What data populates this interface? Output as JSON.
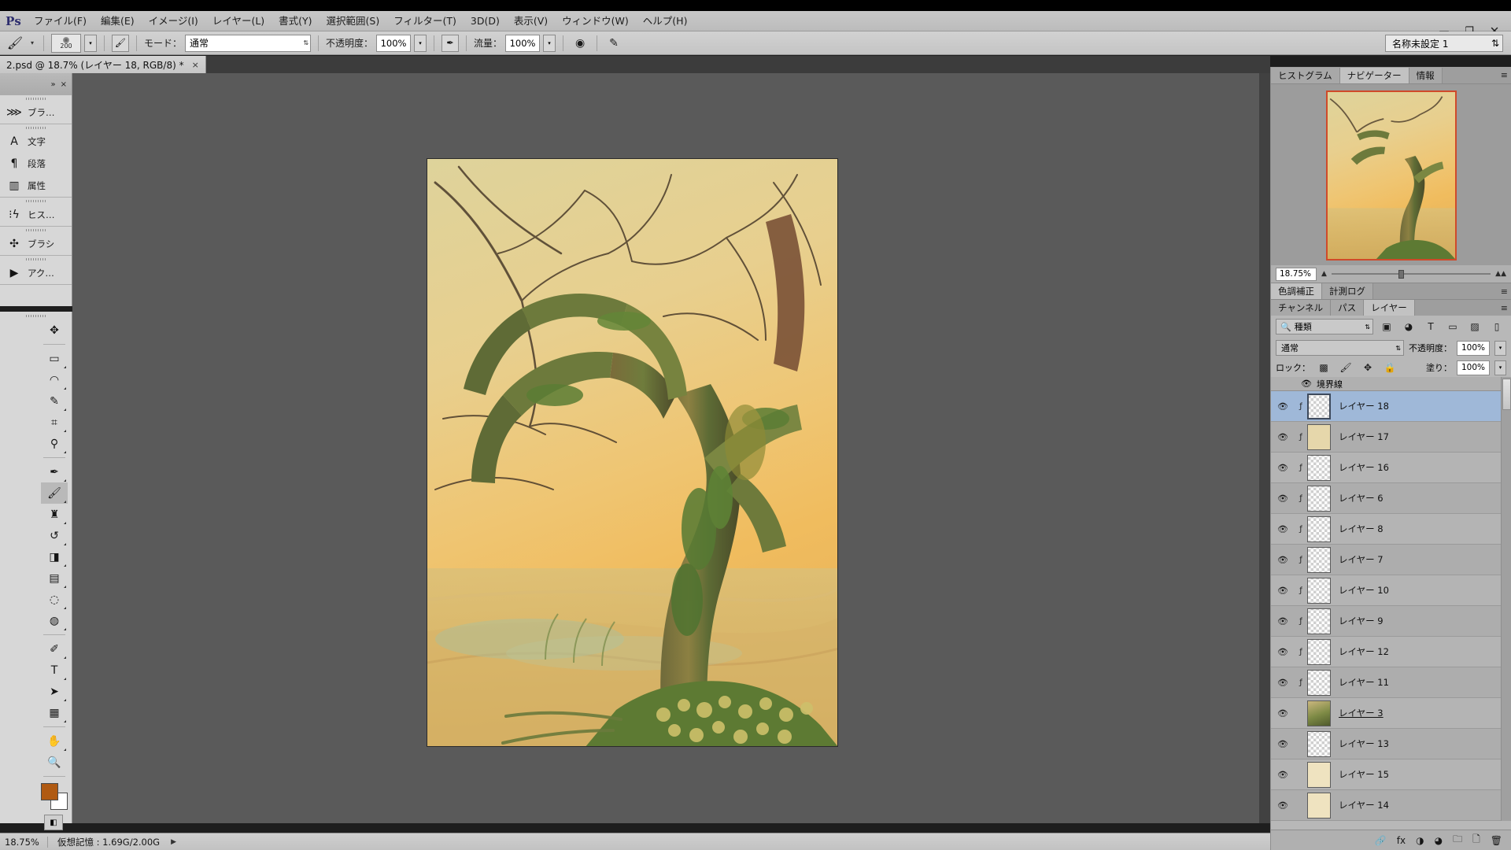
{
  "app": {
    "logo": "Ps",
    "window_controls": [
      {
        "name": "minimize",
        "glyph": "—"
      },
      {
        "name": "maximize",
        "glyph": "❐"
      },
      {
        "name": "close",
        "glyph": "✕"
      }
    ]
  },
  "menubar": {
    "items": [
      {
        "label": "ファイル(F)"
      },
      {
        "label": "編集(E)"
      },
      {
        "label": "イメージ(I)"
      },
      {
        "label": "レイヤー(L)"
      },
      {
        "label": "書式(Y)"
      },
      {
        "label": "選択範囲(S)"
      },
      {
        "label": "フィルター(T)"
      },
      {
        "label": "3D(D)"
      },
      {
        "label": "表示(V)"
      },
      {
        "label": "ウィンドウ(W)"
      },
      {
        "label": "ヘルプ(H)"
      }
    ]
  },
  "options_bar": {
    "tool_icon": "brush-icon",
    "brush_size": "200",
    "brush_preset_icon": "brush-preset-icon",
    "toggle_brush_panel_icon": "brush-panel-toggle-icon",
    "mode_label": "モード：",
    "mode_value": "通常",
    "opacity_label": "不透明度：",
    "opacity_value": "100%",
    "airbrush_icon": "airbrush-icon",
    "flow_label": "流量：",
    "flow_value": "100%",
    "smoothing_icon": "smoothing-icon",
    "tablet_pressure_icon": "tablet-pressure-icon",
    "workspace_value": "名称未設定 1"
  },
  "document_tab": {
    "label": "2.psd @ 18.7% (レイヤー 18, RGB/8) *",
    "close_glyph": "×"
  },
  "left_dock": {
    "collapse_icons": [
      "»",
      "×"
    ],
    "groups": [
      {
        "items": [
          {
            "label": "ブラ…",
            "icon": "brush-settings-icon"
          }
        ]
      },
      {
        "items": [
          {
            "label": "文字",
            "icon": "character-icon"
          },
          {
            "label": "段落",
            "icon": "paragraph-icon"
          },
          {
            "label": "属性",
            "icon": "properties-icon"
          }
        ]
      },
      {
        "items": [
          {
            "label": "ヒス…",
            "icon": "history-icon"
          }
        ]
      },
      {
        "items": [
          {
            "label": "ブラシ",
            "icon": "brushes-icon"
          }
        ]
      },
      {
        "items": [
          {
            "label": "アク…",
            "icon": "actions-icon"
          }
        ]
      }
    ]
  },
  "tools": [
    {
      "name": "move-tool",
      "glyph": "✥",
      "selected": false,
      "has_corner": false
    },
    {
      "name": "rectangular-marquee-tool",
      "glyph": "▭",
      "selected": false,
      "has_corner": true
    },
    {
      "name": "lasso-tool",
      "glyph": "◠",
      "selected": false,
      "has_corner": true
    },
    {
      "name": "quick-selection-tool",
      "glyph": "✎",
      "selected": false,
      "has_corner": true
    },
    {
      "name": "crop-tool",
      "glyph": "⌗",
      "selected": false,
      "has_corner": true
    },
    {
      "name": "eyedropper-tool",
      "glyph": "⚲",
      "selected": false,
      "has_corner": true
    },
    {
      "name": "spot-healing-brush-tool",
      "glyph": "✒",
      "selected": false,
      "has_corner": true
    },
    {
      "name": "brush-tool",
      "glyph": "🖌",
      "selected": true,
      "has_corner": true
    },
    {
      "name": "clone-stamp-tool",
      "glyph": "♜",
      "selected": false,
      "has_corner": true
    },
    {
      "name": "history-brush-tool",
      "glyph": "↺",
      "selected": false,
      "has_corner": true
    },
    {
      "name": "eraser-tool",
      "glyph": "◨",
      "selected": false,
      "has_corner": true
    },
    {
      "name": "gradient-tool",
      "glyph": "▤",
      "selected": false,
      "has_corner": true
    },
    {
      "name": "blur-tool",
      "glyph": "◌",
      "selected": false,
      "has_corner": true
    },
    {
      "name": "dodge-tool",
      "glyph": "◍",
      "selected": false,
      "has_corner": true
    },
    {
      "name": "pen-tool",
      "glyph": "✐",
      "selected": false,
      "has_corner": true
    },
    {
      "name": "horizontal-type-tool",
      "glyph": "T",
      "selected": false,
      "has_corner": true
    },
    {
      "name": "path-selection-tool",
      "glyph": "➤",
      "selected": false,
      "has_corner": true
    },
    {
      "name": "rectangle-tool",
      "glyph": "▦",
      "selected": false,
      "has_corner": true
    },
    {
      "name": "hand-tool",
      "glyph": "✋",
      "selected": false,
      "has_corner": true
    },
    {
      "name": "zoom-tool",
      "glyph": "🔍",
      "selected": false,
      "has_corner": false
    }
  ],
  "tool_extras": {
    "foreground_color": "#b05a12",
    "background_color": "#ffffff",
    "quick_mask_icon": "quick-mask-icon",
    "screen_mode_icon": "screen-mode-icon"
  },
  "status_bar": {
    "zoom": "18.75%",
    "info": "仮想記憶 : 1.69G/2.00G",
    "expand_glyph": "▶"
  },
  "right_dock": {
    "top_tabs": [
      {
        "label": "ヒストグラム",
        "active": false
      },
      {
        "label": "ナビゲーター",
        "active": true
      },
      {
        "label": "情報",
        "active": false
      }
    ],
    "navigator": {
      "zoom_value": "18.75%",
      "zoom_out_icon": "zoom-out-icon",
      "zoom_in_icon": "zoom-in-icon",
      "view_box_color": "#cf4a2a"
    },
    "mid_tabs": [
      {
        "label": "色調補正",
        "active": true
      },
      {
        "label": "計測ログ",
        "active": false
      }
    ],
    "layer_tabs": [
      {
        "label": "チャンネル",
        "active": false
      },
      {
        "label": "パス",
        "active": false
      },
      {
        "label": "レイヤー",
        "active": true
      }
    ],
    "layers_panel": {
      "filter_label": "種類",
      "filter_icon": "search-icon",
      "filter_type_icons": [
        {
          "name": "pixel-filter-icon",
          "glyph": "▣"
        },
        {
          "name": "adjustment-filter-icon",
          "glyph": "◕"
        },
        {
          "name": "type-filter-icon",
          "glyph": "T"
        },
        {
          "name": "shape-filter-icon",
          "glyph": "▭"
        },
        {
          "name": "smart-object-filter-icon",
          "glyph": "▨"
        }
      ],
      "filter_toggle_icon": "filter-toggle-icon",
      "blend_mode": "通常",
      "opacity_label": "不透明度：",
      "opacity_value": "100%",
      "lock_label": "ロック：",
      "lock_icons": [
        {
          "name": "lock-transparent-pixels-icon",
          "glyph": "▩"
        },
        {
          "name": "lock-image-pixels-icon",
          "glyph": "🖌"
        },
        {
          "name": "lock-position-icon",
          "glyph": "✥"
        },
        {
          "name": "lock-all-icon",
          "glyph": "🔒"
        }
      ],
      "fill_label": "塗り：",
      "fill_value": "100%",
      "group_header": {
        "label": "境界線",
        "eye_icon": "eye-icon"
      },
      "layers": [
        {
          "name": "レイヤー 18",
          "selected": true,
          "linked": true,
          "thumb": "transparent",
          "underline": false
        },
        {
          "name": "レイヤー 17",
          "selected": false,
          "linked": true,
          "thumb": "tan",
          "underline": false
        },
        {
          "name": "レイヤー 16",
          "selected": false,
          "linked": true,
          "thumb": "transparent",
          "underline": false
        },
        {
          "name": "レイヤー 6",
          "selected": false,
          "linked": true,
          "thumb": "transparent",
          "underline": false
        },
        {
          "name": "レイヤー 8",
          "selected": false,
          "linked": true,
          "thumb": "transparent",
          "underline": false
        },
        {
          "name": "レイヤー 7",
          "selected": false,
          "linked": true,
          "thumb": "transparent",
          "underline": false
        },
        {
          "name": "レイヤー 10",
          "selected": false,
          "linked": true,
          "thumb": "transparent",
          "underline": false
        },
        {
          "name": "レイヤー 9",
          "selected": false,
          "linked": true,
          "thumb": "transparent",
          "underline": false
        },
        {
          "name": "レイヤー 12",
          "selected": false,
          "linked": true,
          "thumb": "transparent",
          "underline": false
        },
        {
          "name": "レイヤー 11",
          "selected": false,
          "linked": true,
          "thumb": "transparent",
          "underline": false
        },
        {
          "name": "レイヤー 3",
          "selected": false,
          "linked": false,
          "thumb": "art",
          "underline": true
        },
        {
          "name": "レイヤー 13",
          "selected": false,
          "linked": false,
          "thumb": "transparent",
          "underline": false
        },
        {
          "name": "レイヤー 15",
          "selected": false,
          "linked": false,
          "thumb": "tan2",
          "underline": false
        },
        {
          "name": "レイヤー 14",
          "selected": false,
          "linked": false,
          "thumb": "tan2",
          "underline": false
        }
      ],
      "footer_icons": [
        {
          "name": "link-layers-icon",
          "glyph": "🔗"
        },
        {
          "name": "layer-style-icon",
          "glyph": "fx"
        },
        {
          "name": "layer-mask-icon",
          "glyph": "◑"
        },
        {
          "name": "adjustment-layer-icon",
          "glyph": "◕"
        },
        {
          "name": "new-group-icon",
          "glyph": "🗀"
        },
        {
          "name": "new-layer-icon",
          "glyph": "🗋"
        },
        {
          "name": "delete-layer-icon",
          "glyph": "🗑"
        }
      ]
    }
  },
  "canvas": {
    "background_color": "#5a5a5a",
    "artwork_title": "tree painting"
  }
}
